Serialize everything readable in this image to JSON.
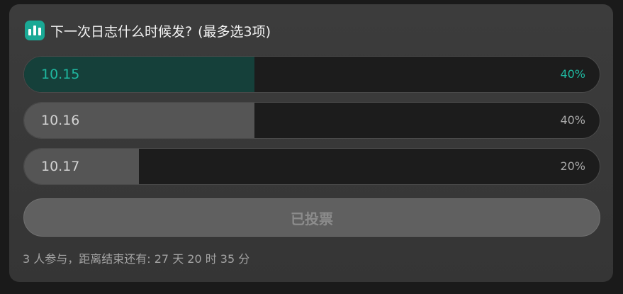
{
  "poll": {
    "title": "下一次日志什么时候发?",
    "subtitle": "(最多选3项)",
    "options": [
      {
        "label": "10.15",
        "percent_text": "40%",
        "percent": 40,
        "selected": true
      },
      {
        "label": "10.16",
        "percent_text": "40%",
        "percent": 40,
        "selected": false
      },
      {
        "label": "10.17",
        "percent_text": "20%",
        "percent": 20,
        "selected": false
      }
    ],
    "vote_button_label": "已投票",
    "footer": "3 人参与，距离结束还有: 27 天 20 时 35 分"
  },
  "icons": {
    "poll": "bar-chart-icon"
  },
  "colors": {
    "accent": "#1fb8a0",
    "icon_bg": "#1aa995",
    "selected_fill": "#15403a",
    "fill": "#555555",
    "track": "#1c1c1c",
    "card_bg": "#3a3a3a",
    "page_bg": "#1a1a1a",
    "voted_button_bg": "#606060"
  }
}
